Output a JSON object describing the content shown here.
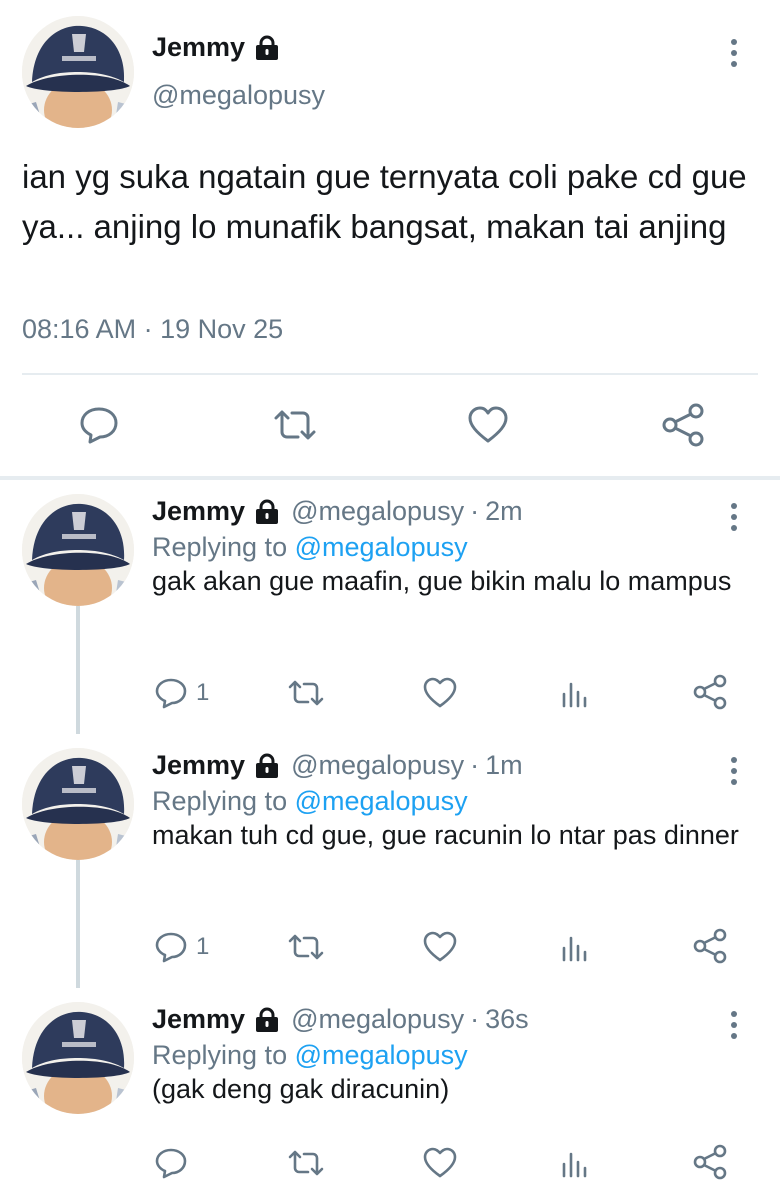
{
  "main_tweet": {
    "name": "Jemmy",
    "handle": "@megalopusy",
    "text": "ian yg suka ngatain gue ternyata coli pake cd gue ya... anjing lo munafik bangsat, makan tai anjing",
    "timestamp": "08:16 AM · 19 Nov 25",
    "icons": [
      "avatar",
      "lock-icon",
      "more-icon",
      "reply-icon",
      "retweet-icon",
      "like-icon",
      "share-icon"
    ]
  },
  "replies": [
    {
      "name": "Jemmy",
      "handle": "@megalopusy",
      "dot": "·",
      "time": "2m",
      "replying_prefix": "Replying to",
      "replying_to": "@megalopusy",
      "text": "gak akan gue maafin, gue bikin malu lo mampus",
      "reply_count": "1"
    },
    {
      "name": "Jemmy",
      "handle": "@megalopusy",
      "dot": "·",
      "time": "1m",
      "replying_prefix": "Replying to",
      "replying_to": "@megalopusy",
      "text": "makan tuh cd gue, gue racunin lo ntar pas dinner",
      "reply_count": "1"
    },
    {
      "name": "Jemmy",
      "handle": "@megalopusy",
      "dot": "·",
      "time": "36s",
      "replying_prefix": "Replying to",
      "replying_to": "@megalopusy",
      "text": "(gak deng gak diracunin)",
      "reply_count": ""
    }
  ],
  "colors": {
    "text": "#14171a",
    "secondary": "#657786",
    "link": "#1da1f2",
    "divider": "#e6ecf0",
    "thread_line": "#cfd9de"
  }
}
